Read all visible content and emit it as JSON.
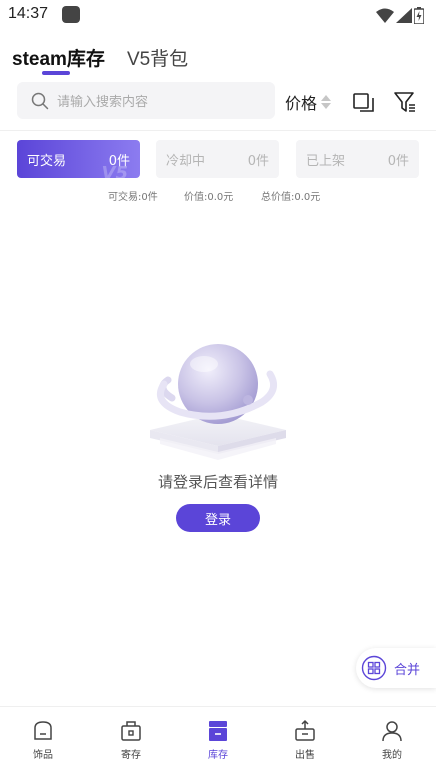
{
  "status_bar": {
    "time": "14:37"
  },
  "tabs": [
    {
      "label": "steam库存",
      "active": true
    },
    {
      "label": "V5背包",
      "active": false
    }
  ],
  "search": {
    "placeholder": "请输入搜索内容"
  },
  "sort": {
    "label": "价格"
  },
  "status_cards": [
    {
      "label": "可交易",
      "count": "0件",
      "active": true
    },
    {
      "label": "冷却中",
      "count": "0件",
      "active": false
    },
    {
      "label": "已上架",
      "count": "0件",
      "active": false
    }
  ],
  "summary": {
    "tradable": "可交易:0件",
    "value": "价值:0.0元",
    "total_value": "总价值:0.0元"
  },
  "empty_state": {
    "message": "请登录后查看详情",
    "login_button": "登录"
  },
  "merge": {
    "label": "合并"
  },
  "bottom_nav": [
    {
      "label": "饰品",
      "icon": "shop-icon",
      "active": false
    },
    {
      "label": "寄存",
      "icon": "deposit-icon",
      "active": false
    },
    {
      "label": "库存",
      "icon": "inventory-icon",
      "active": true
    },
    {
      "label": "出售",
      "icon": "sell-icon",
      "active": false
    },
    {
      "label": "我的",
      "icon": "profile-icon",
      "active": false
    }
  ],
  "colors": {
    "accent": "#5b45d8",
    "accent_light": "#8c7cf0",
    "muted_bg": "#f4f4f6"
  }
}
